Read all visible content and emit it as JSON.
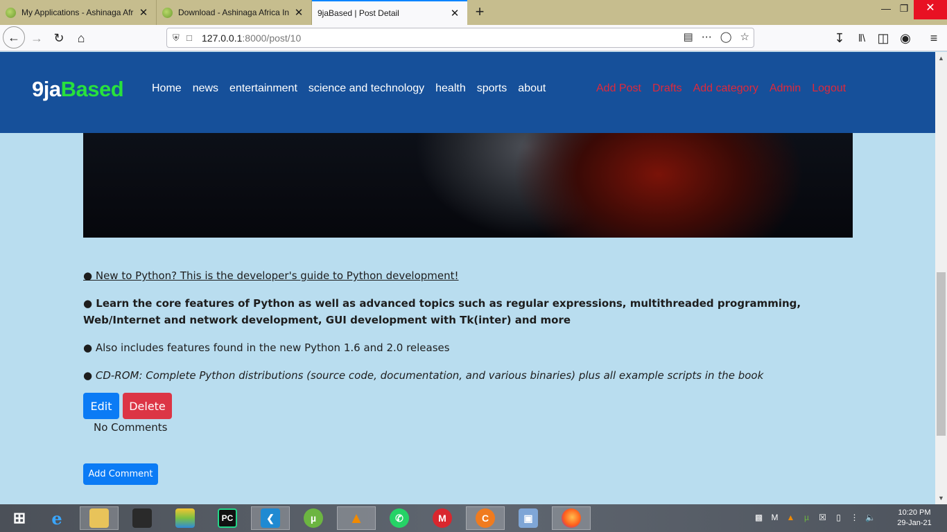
{
  "browser": {
    "tabs": [
      {
        "title": "My Applications - Ashinaga Afr",
        "active": false
      },
      {
        "title": "Download - Ashinaga Africa Ini",
        "active": false
      },
      {
        "title": "9jaBased | Post Detail",
        "active": true
      }
    ],
    "new_tab_glyph": "+",
    "url_host": "127.0.0.1",
    "url_path": ":8000/post/10"
  },
  "site": {
    "brand_part1": "9ja",
    "brand_part2": "Based",
    "brand_color_1": "#ffffff",
    "brand_color_2": "#28e13d",
    "header_color": "#16509a",
    "nav": [
      "Home",
      "news",
      "entertainment",
      "science and technology",
      "health",
      "sports",
      "about"
    ],
    "admin_nav": [
      "Add Post",
      "Drafts",
      "Add category",
      "Admin",
      "Logout"
    ],
    "admin_nav_color": "#e0293b"
  },
  "post": {
    "bullets": [
      "● New to Python? This is the developer's guide to Python development!",
      "● Learn the core features of Python as well as advanced topics such as regular expressions, multithreaded programming, Web/Internet and network development, GUI development with Tk(inter) and more",
      "● Also includes features found in the new Python 1.6 and 2.0 releases",
      "● CD-ROM: Complete Python distributions (source code, documentation, and various binaries) plus all example scripts in the book"
    ],
    "edit_label": "Edit",
    "delete_label": "Delete",
    "no_comments": "No Comments",
    "add_comment_label": "Add Comment"
  },
  "taskbar": {
    "apps": [
      "windows-start-icon",
      "internet-explorer-icon",
      "file-explorer-icon",
      "game-mask-icon",
      "bluestacks-icon",
      "pycharm-icon",
      "vscode-icon",
      "utorrent-icon",
      "vlc-icon",
      "whatsapp-icon",
      "mega-icon",
      "ccleaner-icon",
      "virtualbox-icon",
      "firefox-icon"
    ],
    "time": "10:20 PM",
    "date": "29-Jan-21"
  }
}
